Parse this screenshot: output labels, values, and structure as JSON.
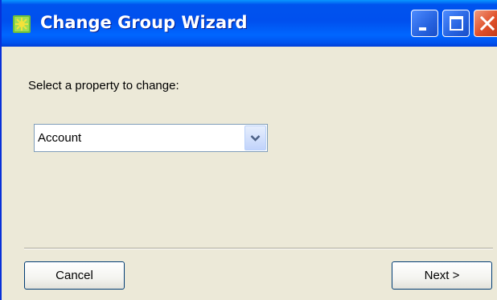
{
  "window": {
    "title": "Change Group Wizard"
  },
  "icons": {
    "title_icon": "wizard-app-icon",
    "minimize": "minimize-icon",
    "maximize": "maximize-icon",
    "close": "close-icon",
    "dropdown": "chevron-down-icon"
  },
  "colors": {
    "title_bar": "#0054e3",
    "dialog_background": "#ece9d8",
    "close_button": "#e0502a",
    "field_border": "#7f9db9"
  },
  "form": {
    "prompt": "Select a property to change:",
    "property_select": {
      "selected": "Account"
    }
  },
  "buttons": {
    "cancel": "Cancel",
    "next": "Next >"
  }
}
